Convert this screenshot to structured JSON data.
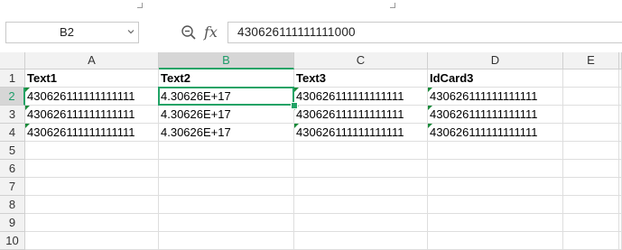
{
  "name_box": {
    "value": "B2"
  },
  "formula_bar": {
    "fx_label": "fx",
    "value": "430626111111111000"
  },
  "columns": [
    "A",
    "B",
    "C",
    "D",
    "E"
  ],
  "rows": [
    "1",
    "2",
    "3",
    "4",
    "5",
    "6",
    "7",
    "8",
    "9",
    "10"
  ],
  "selected": {
    "column": "B",
    "row": "2"
  },
  "cells": [
    [
      "Text1",
      "Text2",
      "Text3",
      "IdCard3",
      ""
    ],
    [
      "430626111111111111",
      "4.30626E+17",
      "430626111111111111",
      "430626111111111111",
      ""
    ],
    [
      "430626111111111111",
      "4.30626E+17",
      "430626111111111111",
      "430626111111111111",
      ""
    ],
    [
      "430626111111111111",
      "4.30626E+17",
      "430626111111111111",
      "430626111111111111",
      ""
    ]
  ],
  "colors": {
    "accent": "#21a366",
    "text_indicator": "#1a8a3a",
    "header_bg": "#f2f2f2",
    "selected_header_bg": "#d6d6d6"
  },
  "icons": {
    "zoom": "zoom-icon",
    "fx": "function-icon",
    "dropdown": "chevron-down-icon"
  }
}
